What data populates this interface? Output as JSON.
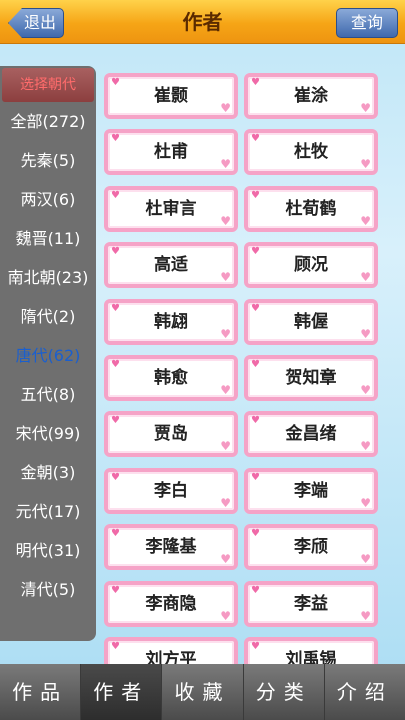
{
  "header": {
    "title": "作者",
    "back_label": "退出",
    "query_label": "查询"
  },
  "sidebar": {
    "title": "选择朝代",
    "items": [
      {
        "label": "全部(272)",
        "active": false
      },
      {
        "label": "先秦(5)",
        "active": false
      },
      {
        "label": "两汉(6)",
        "active": false
      },
      {
        "label": "魏晋(11)",
        "active": false
      },
      {
        "label": "南北朝(23)",
        "active": false
      },
      {
        "label": "隋代(2)",
        "active": false
      },
      {
        "label": "唐代(62)",
        "active": true
      },
      {
        "label": "五代(8)",
        "active": false
      },
      {
        "label": "宋代(99)",
        "active": false
      },
      {
        "label": "金朝(3)",
        "active": false
      },
      {
        "label": "元代(17)",
        "active": false
      },
      {
        "label": "明代(31)",
        "active": false
      },
      {
        "label": "清代(5)",
        "active": false
      }
    ]
  },
  "authors": [
    [
      "崔颢",
      "崔涂"
    ],
    [
      "杜甫",
      "杜牧"
    ],
    [
      "杜审言",
      "杜荀鹤"
    ],
    [
      "高适",
      "顾况"
    ],
    [
      "韩翃",
      "韩偓"
    ],
    [
      "韩愈",
      "贺知章"
    ],
    [
      "贾岛",
      "金昌绪"
    ],
    [
      "李白",
      "李端"
    ],
    [
      "李隆基",
      "李颀"
    ],
    [
      "李商隐",
      "李益"
    ],
    [
      "刘方平",
      "刘禹锡"
    ]
  ],
  "tabs": [
    {
      "label": "作品",
      "active": false
    },
    {
      "label": "作者",
      "active": true
    },
    {
      "label": "收藏",
      "active": false
    },
    {
      "label": "分类",
      "active": false
    },
    {
      "label": "介绍",
      "active": false
    }
  ]
}
